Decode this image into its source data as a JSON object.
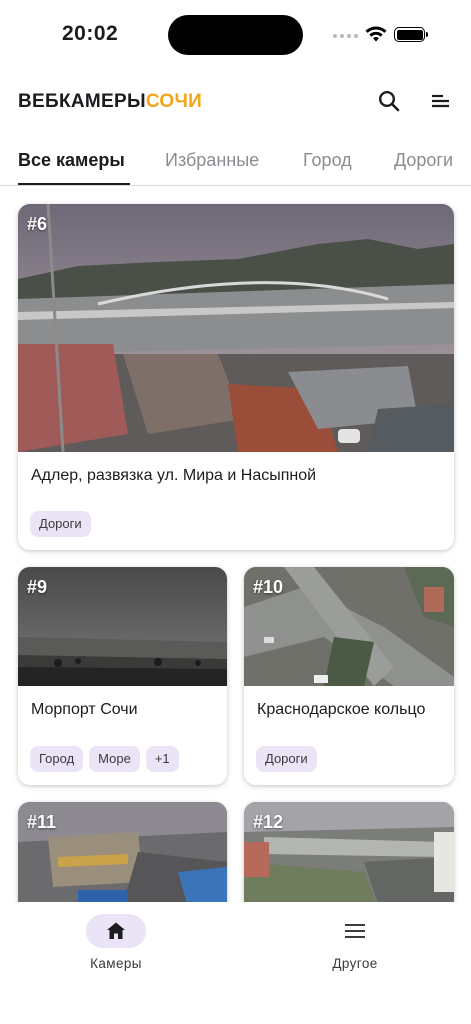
{
  "status_bar": {
    "time": "20:02"
  },
  "header": {
    "logo_part1": "ВЕБКАМЕРЫ",
    "logo_part2": "СОЧИ",
    "accent_color": "#f3a61b"
  },
  "tabs": [
    {
      "label": "Все камеры",
      "active": true
    },
    {
      "label": "Избранные"
    },
    {
      "label": "Город"
    },
    {
      "label": "Дороги"
    }
  ],
  "cameras": [
    {
      "number": "#6",
      "title": "Адлер, развязка ул. Мира и Насыпной",
      "tags": [
        "Дороги"
      ]
    },
    {
      "number": "#9",
      "title": "Морпорт Сочи",
      "tags": [
        "Город",
        "Море",
        "+1"
      ]
    },
    {
      "number": "#10",
      "title": "Краснодарское кольцо",
      "tags": [
        "Дороги"
      ]
    },
    {
      "number": "#11"
    },
    {
      "number": "#12"
    }
  ],
  "bottom_nav": [
    {
      "label": "Камеры",
      "icon": "home-icon",
      "active": true
    },
    {
      "label": "Другое",
      "icon": "menu-icon"
    }
  ]
}
